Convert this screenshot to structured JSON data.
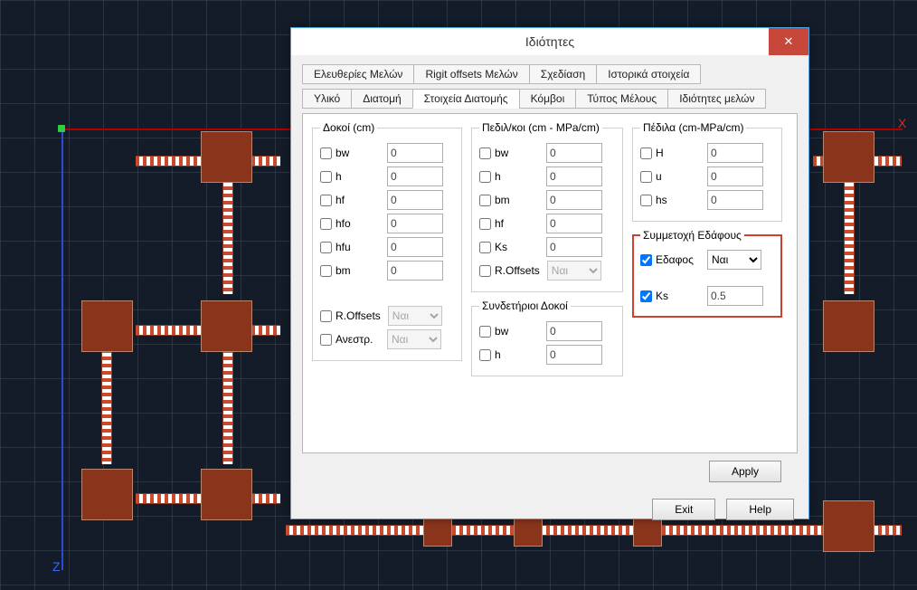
{
  "axis": {
    "x": "X",
    "z": "Z"
  },
  "dialog": {
    "title": "Ιδιότητες",
    "close": "✕",
    "tabs_row1": [
      "Ελευθερίες Μελών",
      "Rigit offsets Μελών",
      "Σχεδίαση",
      "Ιστορικά στοιχεία"
    ],
    "tabs_row2": [
      "Υλικό",
      "Διατομή",
      "Στοιχεία Διατομής",
      "Κόμβοι",
      "Τύπος Μέλους",
      "Ιδιότητες μελών"
    ],
    "active_tab": "Στοιχεία Διατομής",
    "apply": "Apply",
    "exit": "Exit",
    "help": "Help"
  },
  "groups": {
    "dokoi": {
      "legend": "Δοκοί (cm)",
      "bw": {
        "label": "bw",
        "value": "0"
      },
      "h": {
        "label": "h",
        "value": "0"
      },
      "hf": {
        "label": "hf",
        "value": "0"
      },
      "hfo": {
        "label": "hfo",
        "value": "0"
      },
      "hfu": {
        "label": "hfu",
        "value": "0"
      },
      "bm": {
        "label": "bm",
        "value": "0"
      },
      "roffsets": {
        "label": "R.Offsets",
        "value": "Ναι"
      },
      "anestr": {
        "label": "Ανεστρ.",
        "value": "Ναι"
      }
    },
    "pedilkoi": {
      "legend": "Πεδιλ/κοι (cm - MPa/cm)",
      "bw": {
        "label": "bw",
        "value": "0"
      },
      "h": {
        "label": "h",
        "value": "0"
      },
      "bm": {
        "label": "bm",
        "value": "0"
      },
      "hf": {
        "label": "hf",
        "value": "0"
      },
      "ks": {
        "label": "Ks",
        "value": "0"
      },
      "roffsets": {
        "label": "R.Offsets",
        "value": "Ναι"
      }
    },
    "syndet": {
      "legend": "Συνδετήριοι Δοκοί",
      "bw": {
        "label": "bw",
        "value": "0"
      },
      "h": {
        "label": "h",
        "value": "0"
      }
    },
    "pedila": {
      "legend": "Πέδιλα (cm-MPa/cm)",
      "H": {
        "label": "H",
        "value": "0"
      },
      "u": {
        "label": "u",
        "value": "0"
      },
      "hs": {
        "label": "hs",
        "value": "0"
      }
    },
    "edafos": {
      "legend": "Συμμετοχή Εδάφους",
      "edafos": {
        "label": "Εδαφος",
        "value": "Ναι",
        "checked": true
      },
      "ks": {
        "label": "Ks",
        "value": "0.5",
        "checked": true
      }
    }
  }
}
